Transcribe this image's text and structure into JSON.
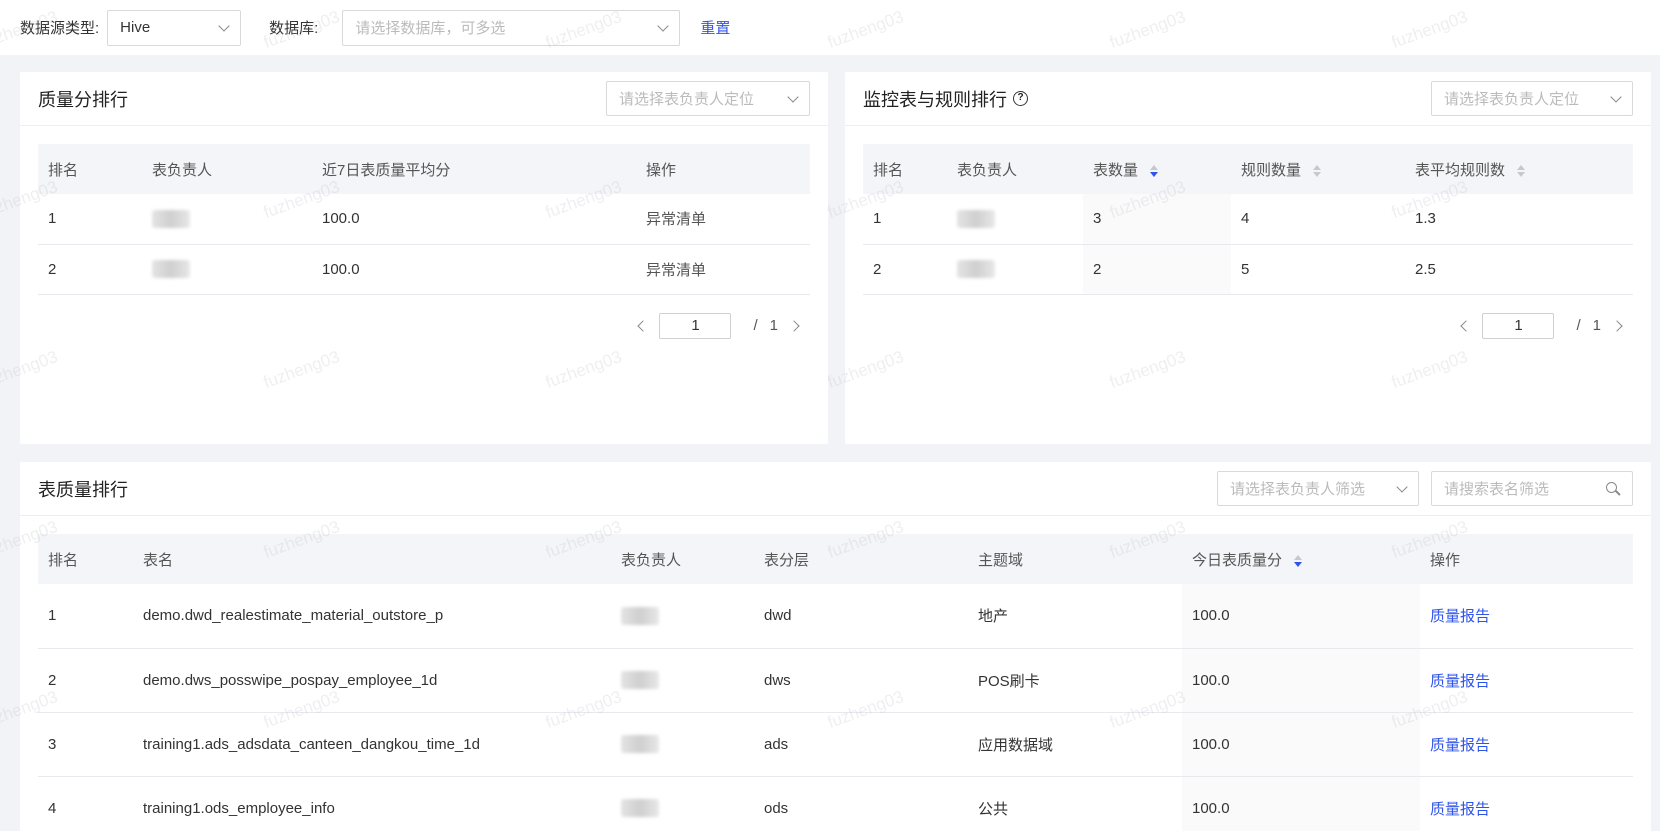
{
  "filters": {
    "source_type_label": "数据源类型:",
    "source_type_value": "Hive",
    "database_label": "数据库:",
    "database_placeholder": "请选择数据库，可多选",
    "reset_label": "重置"
  },
  "quality_rank": {
    "title": "质量分排行",
    "owner_select_placeholder": "请选择表负责人定位",
    "columns": [
      "排名",
      "表负责人",
      "近7日表质量平均分",
      "操作"
    ],
    "rows": [
      {
        "rank": "1",
        "score": "100.0",
        "action": "异常清单"
      },
      {
        "rank": "2",
        "score": "100.0",
        "action": "异常清单"
      }
    ],
    "page": "1",
    "page_sep": "/",
    "total_pages": "1"
  },
  "monitor_rank": {
    "title": "监控表与规则排行",
    "owner_select_placeholder": "请选择表负责人定位",
    "columns": [
      "排名",
      "表负责人",
      "表数量",
      "规则数量",
      "表平均规则数"
    ],
    "rows": [
      {
        "rank": "1",
        "tables": "3",
        "rules": "4",
        "avg": "1.3"
      },
      {
        "rank": "2",
        "tables": "2",
        "rules": "5",
        "avg": "2.5"
      }
    ],
    "page": "1",
    "page_sep": "/",
    "total_pages": "1"
  },
  "table_rank": {
    "title": "表质量排行",
    "owner_filter_placeholder": "请选择表负责人筛选",
    "search_placeholder": "请搜索表名筛选",
    "columns": [
      "排名",
      "表名",
      "表负责人",
      "表分层",
      "主题域",
      "今日表质量分",
      "操作"
    ],
    "rows": [
      {
        "rank": "1",
        "name": "demo.dwd_realestimate_material_outstore_p",
        "layer": "dwd",
        "domain": "地产",
        "score": "100.0",
        "action": "质量报告"
      },
      {
        "rank": "2",
        "name": "demo.dws_posswipe_pospay_employee_1d",
        "layer": "dws",
        "domain": "POS刷卡",
        "score": "100.0",
        "action": "质量报告"
      },
      {
        "rank": "3",
        "name": "training1.ads_adsdata_canteen_dangkou_time_1d",
        "layer": "ads",
        "domain": "应用数据域",
        "score": "100.0",
        "action": "质量报告"
      },
      {
        "rank": "4",
        "name": "training1.ods_employee_info",
        "layer": "ods",
        "domain": "公共",
        "score": "100.0",
        "action": "质量报告"
      }
    ]
  },
  "watermark_text": "fuzheng03",
  "colors": {
    "link": "#2f54eb",
    "header_bg": "#f4f5f8",
    "page_bg": "#f2f3f7"
  }
}
